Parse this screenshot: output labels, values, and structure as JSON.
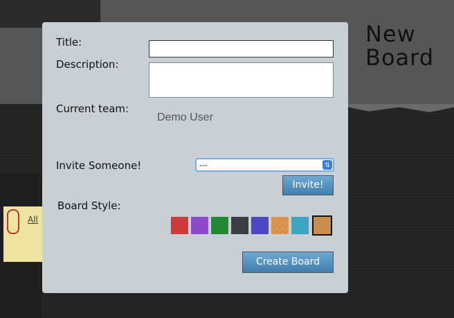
{
  "side_title": "New Board",
  "sticky_note": "All",
  "form": {
    "title_label": "Title:",
    "title_value": "",
    "description_label": "Description:",
    "description_value": "",
    "team_label": "Current team:",
    "team_value": "Demo User",
    "invite_label": "Invite Someone!",
    "invite_select_value": "---",
    "invite_button": "Invite!",
    "style_label": "Board Style:",
    "swatches": [
      {
        "name": "red",
        "color": "#d13a3a"
      },
      {
        "name": "purple",
        "color": "#8e4bc9"
      },
      {
        "name": "green",
        "color": "#238a34"
      },
      {
        "name": "charcoal",
        "color": "#3c4044"
      },
      {
        "name": "indigo",
        "color": "#4b48c4"
      },
      {
        "name": "orange-lattice",
        "color": "#d9924a"
      },
      {
        "name": "teal",
        "color": "#3ba5c2"
      },
      {
        "name": "tan",
        "color": "#c98e4b",
        "selected": true
      }
    ],
    "create_button": "Create Board"
  }
}
